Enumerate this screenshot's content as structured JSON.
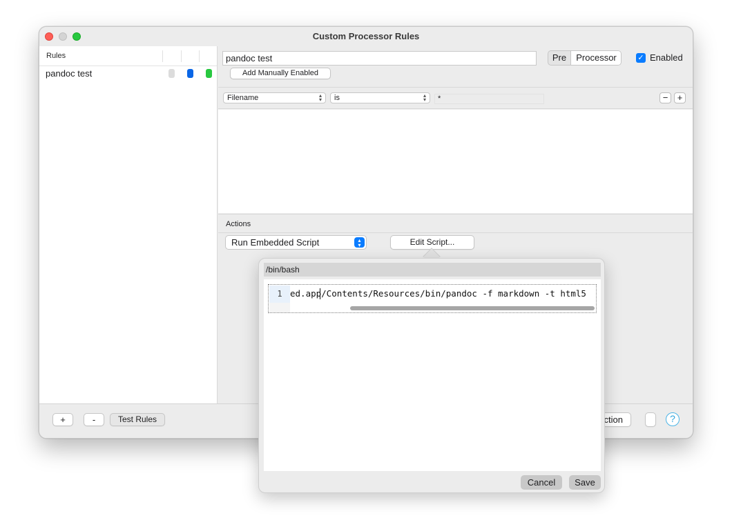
{
  "window": {
    "title": "Custom Processor Rules"
  },
  "sidebar": {
    "header": "Rules",
    "rules": [
      {
        "name": "pandoc test",
        "colors": [
          "#dcdcdc",
          "#0a66e6",
          "#28c840"
        ]
      }
    ]
  },
  "bottom_bar": {
    "add_label": "+",
    "remove_label": "-",
    "test_label": "Test Rules",
    "action_label_partial": "ction",
    "help_label": "?"
  },
  "rule_editor": {
    "name_value": "pandoc test",
    "segment": {
      "pre": "Pre",
      "processor": "Processor"
    },
    "enabled_label": "Enabled",
    "enabled": true,
    "add_manual_label": "Add Manually Enabled",
    "criteria": {
      "field": "Filename",
      "operator": "is",
      "pattern": "*",
      "minus": "−",
      "plus": "+"
    }
  },
  "actions": {
    "header": "Actions",
    "action_type": "Run Embedded Script",
    "edit_script_label": "Edit Script..."
  },
  "script_popover": {
    "interpreter": "/bin/bash",
    "line_number": "1",
    "code_visible": "ed.app/Contents/Resources/bin/pandoc -f markdown -t html5",
    "cancel_label": "Cancel",
    "save_label": "Save"
  },
  "colors": {
    "accent": "#0a7cff",
    "close": "#fe5f57",
    "zoom": "#28c840"
  }
}
